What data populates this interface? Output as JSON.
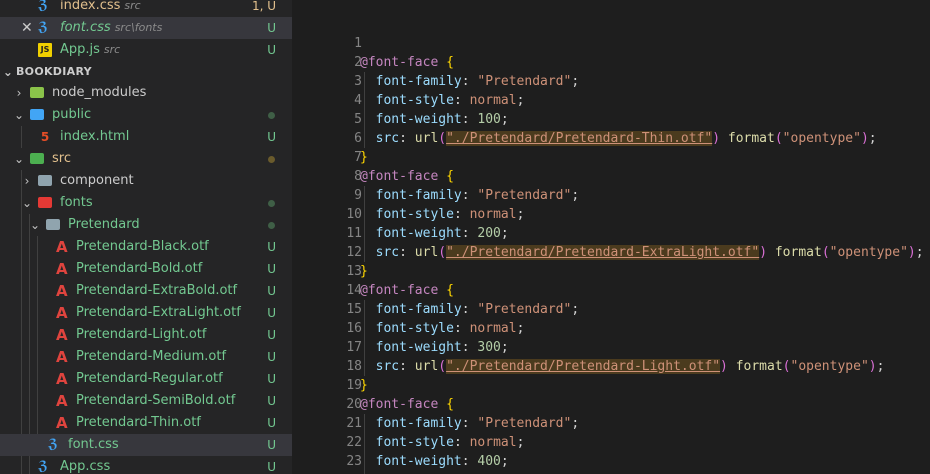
{
  "open_editors": [
    {
      "label": "index.css",
      "desc": "src",
      "status": "1, U"
    },
    {
      "label": "font.css",
      "desc": "src\\fonts",
      "status": "U"
    },
    {
      "label": "App.js",
      "desc": "src",
      "status": "U"
    }
  ],
  "explorer": {
    "section_title": "BOOKDIARY",
    "items": [
      {
        "label": "node_modules"
      },
      {
        "label": "public"
      },
      {
        "label": "index.html",
        "status": "U"
      },
      {
        "label": "src"
      },
      {
        "label": "component"
      },
      {
        "label": "fonts"
      },
      {
        "label": "Pretendard"
      },
      {
        "label": "Pretendard-Black.otf",
        "status": "U"
      },
      {
        "label": "Pretendard-Bold.otf",
        "status": "U"
      },
      {
        "label": "Pretendard-ExtraBold.otf",
        "status": "U"
      },
      {
        "label": "Pretendard-ExtraLight.otf",
        "status": "U"
      },
      {
        "label": "Pretendard-Light.otf",
        "status": "U"
      },
      {
        "label": "Pretendard-Medium.otf",
        "status": "U"
      },
      {
        "label": "Pretendard-Regular.otf",
        "status": "U"
      },
      {
        "label": "Pretendard-SemiBold.otf",
        "status": "U"
      },
      {
        "label": "Pretendard-Thin.otf",
        "status": "U"
      },
      {
        "label": "font.css",
        "status": "U"
      },
      {
        "label": "App.css",
        "status": "U"
      }
    ]
  },
  "editor": {
    "line_numbers": [
      "1",
      "2",
      "3",
      "4",
      "5",
      "6",
      "7",
      "8",
      "9",
      "10",
      "11",
      "12",
      "13",
      "14",
      "15",
      "16",
      "17",
      "18",
      "19",
      "20",
      "21",
      "22",
      "23"
    ],
    "tokens": {
      "at_rule": "@font-face",
      "open_brace": "{",
      "close_brace": "}",
      "prop_family": "font-family",
      "prop_style": "font-style",
      "prop_weight": "font-weight",
      "prop_src": "src",
      "colon": ":",
      "semicolon": ";",
      "family_value": "\"Pretendard\"",
      "style_value": "normal",
      "url_fn": "url",
      "format_fn": "format",
      "format_value": "\"opentype\"",
      "weights": [
        "100",
        "200",
        "300",
        "400"
      ],
      "urls": [
        "\"./Pretendard/Pretendard-Thin.otf\"",
        "\"./Pretendard/Pretendard-ExtraLight.otf\"",
        "\"./Pretendard/Pretendard-Light.otf\""
      ]
    }
  },
  "colors": {
    "background": "#1e1e1e",
    "sidebar": "#252526",
    "untracked": "#73c991",
    "modified": "#e2c08d"
  }
}
